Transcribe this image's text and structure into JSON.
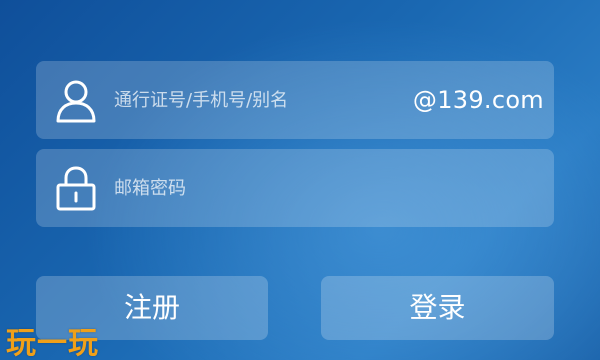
{
  "login_form": {
    "username": {
      "placeholder": "通行证号/手机号/别名",
      "value": "",
      "domain_suffix": "@139.com",
      "icon": "user-icon"
    },
    "password": {
      "placeholder": "邮箱密码",
      "value": "",
      "icon": "lock-icon"
    },
    "buttons": {
      "register_label": "注册",
      "login_label": "登录"
    }
  },
  "watermark": {
    "text": "玩一玩"
  },
  "colors": {
    "background": "#1a68b2",
    "field_fill": "rgba(255,255,255,0.20)",
    "text": "#ffffff",
    "watermark": "#f0a019"
  }
}
